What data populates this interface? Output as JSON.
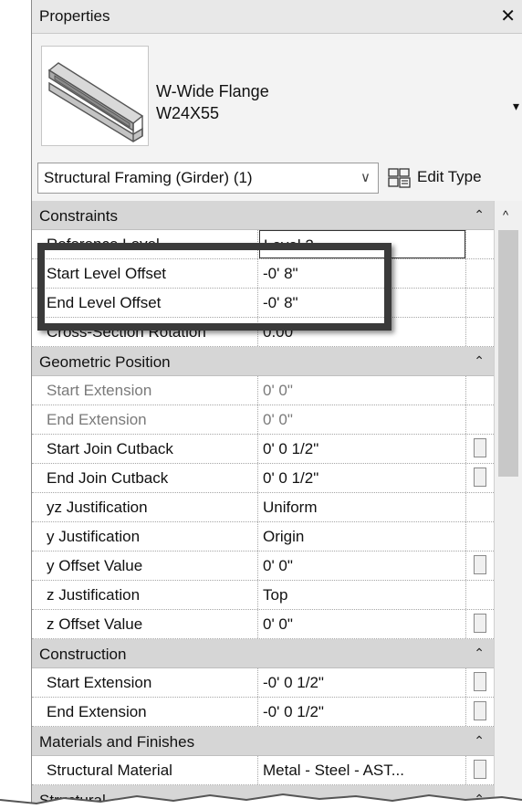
{
  "panel": {
    "title": "Properties",
    "close_glyph": "✕"
  },
  "type_selector": {
    "family": "W-Wide Flange",
    "type": "W24X55",
    "dropdown_glyph": "▾",
    "thumbnail_icon": "wide-flange-beam-icon"
  },
  "instance_selector": {
    "value": "Structural Framing (Girder) (1)",
    "chevron_glyph": "∨",
    "edit_type_label": "Edit Type",
    "edit_type_icon": "edit-type-icon"
  },
  "colors": {
    "group_header": "#d6d6d6",
    "highlight_box": "#3a3a3a"
  },
  "groups": [
    {
      "name": "Constraints",
      "collapse_glyph": "⌃",
      "rows": [
        {
          "name": "Reference Level",
          "value": "Level 2"
        },
        {
          "name": "Start Level Offset",
          "value": "-0'  8\""
        },
        {
          "name": "End Level Offset",
          "value": "-0'  8\""
        },
        {
          "name": "Cross-Section Rotation",
          "value": "0.00°"
        }
      ]
    },
    {
      "name": "Geometric Position",
      "collapse_glyph": "⌃",
      "rows": [
        {
          "name": "Start Extension",
          "value": "0'  0\""
        },
        {
          "name": "End Extension",
          "value": "0'  0\""
        },
        {
          "name": "Start Join Cutback",
          "value": "0'  0 1/2\""
        },
        {
          "name": "End Join Cutback",
          "value": "0'  0 1/2\""
        },
        {
          "name": "yz Justification",
          "value": "Uniform"
        },
        {
          "name": "y Justification",
          "value": "Origin"
        },
        {
          "name": "y Offset Value",
          "value": "0'  0\""
        },
        {
          "name": "z Justification",
          "value": "Top"
        },
        {
          "name": "z Offset Value",
          "value": "0'  0\""
        }
      ]
    },
    {
      "name": "Construction",
      "collapse_glyph": "⌃",
      "rows": [
        {
          "name": "Start Extension",
          "value": "-0'  0 1/2\""
        },
        {
          "name": "End Extension",
          "value": "-0'  0 1/2\""
        }
      ]
    },
    {
      "name": "Materials and Finishes",
      "collapse_glyph": "⌃",
      "rows": [
        {
          "name": "Structural Material",
          "value": "Metal - Steel - AST..."
        }
      ]
    },
    {
      "name": "Structural",
      "collapse_glyph": "⌃",
      "rows": []
    }
  ],
  "scrollbar": {
    "up_glyph": "^"
  }
}
